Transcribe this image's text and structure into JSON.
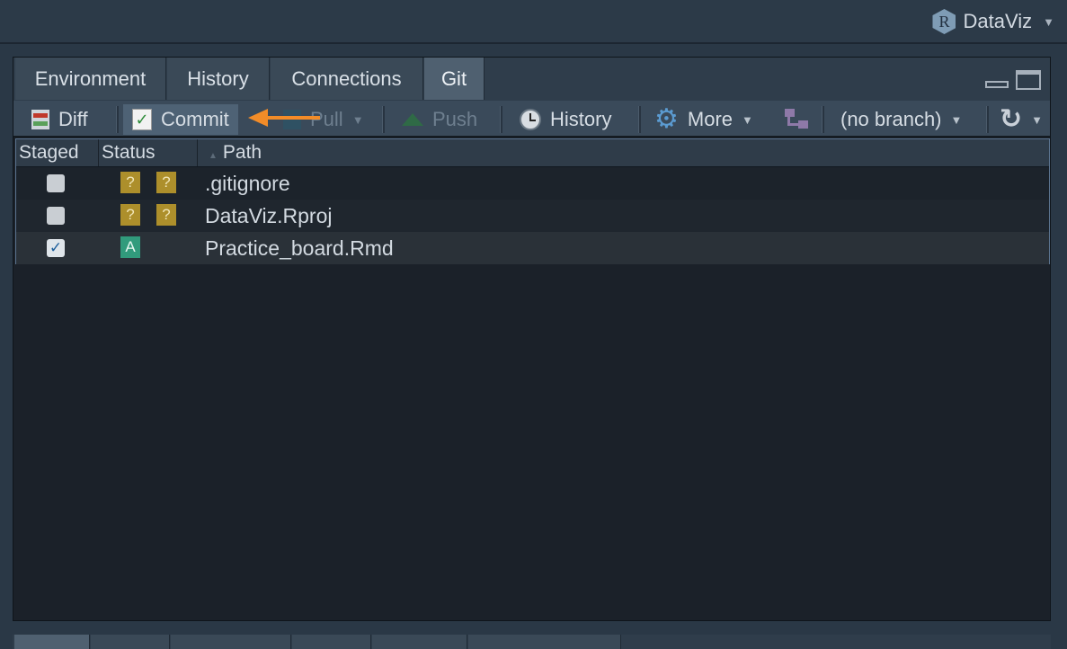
{
  "project": {
    "icon": "r-project-icon",
    "name": "DataViz"
  },
  "tabs": [
    {
      "label": "Environment",
      "active": false
    },
    {
      "label": "History",
      "active": false
    },
    {
      "label": "Connections",
      "active": false
    },
    {
      "label": "Git",
      "active": true
    }
  ],
  "toolbar": {
    "diff": "Diff",
    "commit": "Commit",
    "pull": "Pull",
    "push": "Push",
    "history": "History",
    "more": "More",
    "branch": "(no branch)"
  },
  "table": {
    "headers": {
      "staged": "Staged",
      "status": "Status",
      "path": "Path"
    },
    "rows": [
      {
        "staged": false,
        "status": [
          "?",
          "?"
        ],
        "path": ".gitignore"
      },
      {
        "staged": false,
        "status": [
          "?",
          "?"
        ],
        "path": "DataViz.Rproj"
      },
      {
        "staged": true,
        "status": [
          "A"
        ],
        "path": "Practice_board.Rmd"
      }
    ]
  },
  "colors": {
    "accent_arrow": "#f28c28",
    "untracked_badge": "#ad8f2b",
    "added_badge": "#319b7c"
  }
}
